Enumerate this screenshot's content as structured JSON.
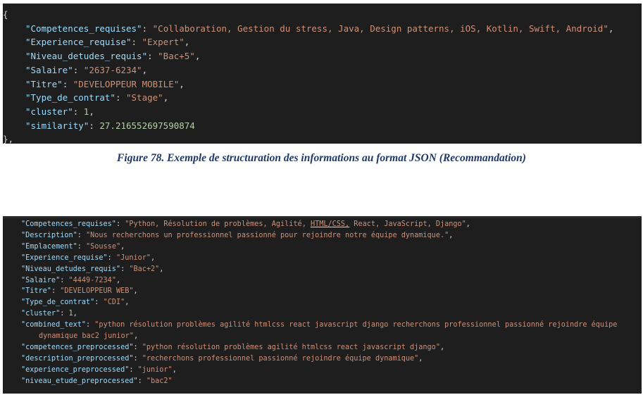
{
  "figure_top": {
    "open": "{",
    "close": "},",
    "lines": [
      {
        "key": "\"Competences_requises\"",
        "type": "str",
        "value": "\"Collaboration, Gestion du stress, Java, Design patterns, iOS, Kotlin, Swift, Android\"",
        "tail": ","
      },
      {
        "key": "\"Experience_requise\"",
        "type": "str",
        "value": "\"Expert\"",
        "tail": ","
      },
      {
        "key": "\"Niveau_detudes_requis\"",
        "type": "str",
        "value": "\"Bac+5\"",
        "tail": ","
      },
      {
        "key": "\"Salaire\"",
        "type": "str",
        "value": "\"2637-6234\"",
        "tail": ","
      },
      {
        "key": "\"Titre\"",
        "type": "str",
        "value": "\"DEVELOPPEUR MOBILE\"",
        "tail": ","
      },
      {
        "key": "\"Type_de_contrat\"",
        "type": "str",
        "value": "\"Stage\"",
        "tail": ","
      },
      {
        "key": "\"cluster\"",
        "type": "num",
        "value": "1",
        "tail": ","
      },
      {
        "key": "\"similarity\"",
        "type": "num",
        "value": "27.216552697590874",
        "tail": ""
      }
    ]
  },
  "caption": "Figure 78. Exemple de structuration des informations au format JSON (Recommandation)",
  "figure_bottom": {
    "lines": [
      {
        "key": "\"Competences_requises\"",
        "type": "str",
        "value_parts": [
          "\"Python, Résolution de problèmes, Agilité, ",
          "HTML/CSS,",
          " React, JavaScript, Django\""
        ],
        "tail": ","
      },
      {
        "key": "\"Description\"",
        "type": "str",
        "value": "\"Nous recherchons un professionnel passionné pour rejoindre notre équipe dynamique.\"",
        "tail": ","
      },
      {
        "key": "\"Emplacement\"",
        "type": "str",
        "value": "\"Sousse\"",
        "tail": ","
      },
      {
        "key": "\"Experience_requise\"",
        "type": "str",
        "value": "\"Junior\"",
        "tail": ","
      },
      {
        "key": "\"Niveau_detudes_requis\"",
        "type": "str",
        "value": "\"Bac+2\"",
        "tail": ","
      },
      {
        "key": "\"Salaire\"",
        "type": "str",
        "value": "\"4449-7234\"",
        "tail": ","
      },
      {
        "key": "\"Titre\"",
        "type": "str",
        "value": "\"DEVELOPPEUR WEB\"",
        "tail": ","
      },
      {
        "key": "\"Type_de_contrat\"",
        "type": "str",
        "value": "\"CDI\"",
        "tail": ","
      },
      {
        "key": "\"cluster\"",
        "type": "num",
        "value": "1",
        "tail": ","
      },
      {
        "key": "\"combined_text\"",
        "type": "str",
        "value": "\"python résolution problèmes agilité htmlcss react javascript django recherchons professionnel passionné rejoindre équipe",
        "tail": ""
      },
      {
        "wrap": "dynamique bac2 junior\"",
        "tail": ","
      },
      {
        "key": "\"competences_preprocessed\"",
        "type": "str",
        "value": "\"python résolution problèmes agilité htmlcss react javascript django\"",
        "tail": ","
      },
      {
        "key": "\"description_preprocessed\"",
        "type": "str",
        "value": "\"recherchons professionnel passionné rejoindre équipe dynamique\"",
        "tail": ","
      },
      {
        "key": "\"experience_preprocessed\"",
        "type": "str",
        "value": "\"junior\"",
        "tail": ","
      },
      {
        "key": "\"niveau_etude_preprocessed\"",
        "type": "str",
        "value": "\"bac2\"",
        "tail": ""
      }
    ]
  }
}
